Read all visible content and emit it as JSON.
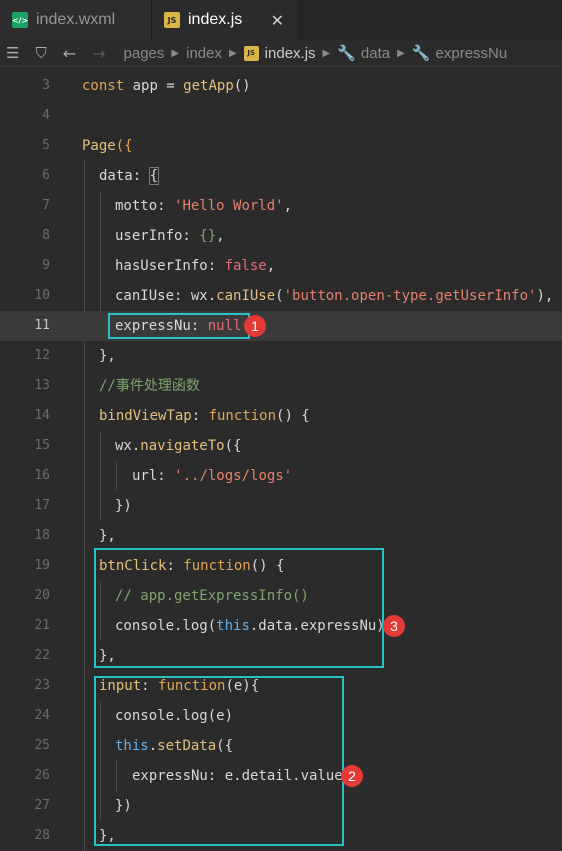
{
  "tabs": [
    {
      "label": "index.wxml",
      "icon": "wxml-file-icon"
    },
    {
      "label": "index.js",
      "icon": "js-file-icon",
      "close": "✕"
    }
  ],
  "breadcrumb": {
    "pages": "pages",
    "index": "index",
    "file": "index.js",
    "data": "data",
    "field": "expressNu"
  },
  "code": {
    "line_numbers": [
      "3",
      "4",
      "5",
      "6",
      "7",
      "8",
      "9",
      "10",
      "11",
      "12",
      "13",
      "14",
      "15",
      "16",
      "17",
      "18",
      "19",
      "20",
      "21",
      "22",
      "23",
      "24",
      "25",
      "26",
      "27",
      "28"
    ],
    "l3": {
      "const": "const",
      "app": " app = ",
      "getApp": "getApp",
      "paren": "()"
    },
    "l5": {
      "page": "Page",
      "open": "({"
    },
    "l6": {
      "data": "data",
      "colon": ": ",
      "brace": "{"
    },
    "l7": {
      "key": "motto: ",
      "str": "'Hello World'",
      "comma": ","
    },
    "l8": {
      "key": "userInfo: ",
      "val": "{}",
      "comma": ","
    },
    "l9": {
      "key": "hasUserInfo: ",
      "val": "false",
      "comma": ","
    },
    "l10": {
      "key": "canIUse: wx.",
      "fn": "canIUse",
      "open": "(",
      "str": "'button.open-type.getUserInfo'",
      "close": "),"
    },
    "l11": {
      "key": "expressNu: ",
      "val": "null"
    },
    "l12": {
      "text": "},"
    },
    "l13": {
      "comment": "//事件处理函数"
    },
    "l14": {
      "name": "bindViewTap",
      "colon": ": ",
      "kw": "function",
      "rest": "() {"
    },
    "l15": {
      "obj": "wx.",
      "fn": "navigateTo",
      "rest": "({"
    },
    "l16": {
      "key": "url: ",
      "str": "'../logs/logs'"
    },
    "l17": {
      "text": "})"
    },
    "l18": {
      "text": "},"
    },
    "l19": {
      "name": "btnClick",
      "colon": ": ",
      "kw": "function",
      "rest": "() {"
    },
    "l20": {
      "comment": "// app.getExpressInfo()"
    },
    "l21": {
      "a": "console.log(",
      "this": "this",
      "b": ".data.expressNu)"
    },
    "l22": {
      "text": "},"
    },
    "l23": {
      "name": "input",
      "colon": ": ",
      "kw": "function",
      "rest": "(e){"
    },
    "l24": {
      "text": "console.log(e)"
    },
    "l25": {
      "this": "this",
      "dot": ".",
      "fn": "setData",
      "rest": "({"
    },
    "l26": {
      "text": "expressNu: e.detail.value"
    },
    "l27": {
      "text": "})"
    },
    "l28": {
      "text": "},"
    }
  },
  "badges": {
    "b1": "1",
    "b2": "2",
    "b3": "3"
  },
  "colors": {
    "annotation_box": "#2ac0c8",
    "badge": "#e53935",
    "keyword": "#e0a552",
    "string": "#e6806b"
  }
}
